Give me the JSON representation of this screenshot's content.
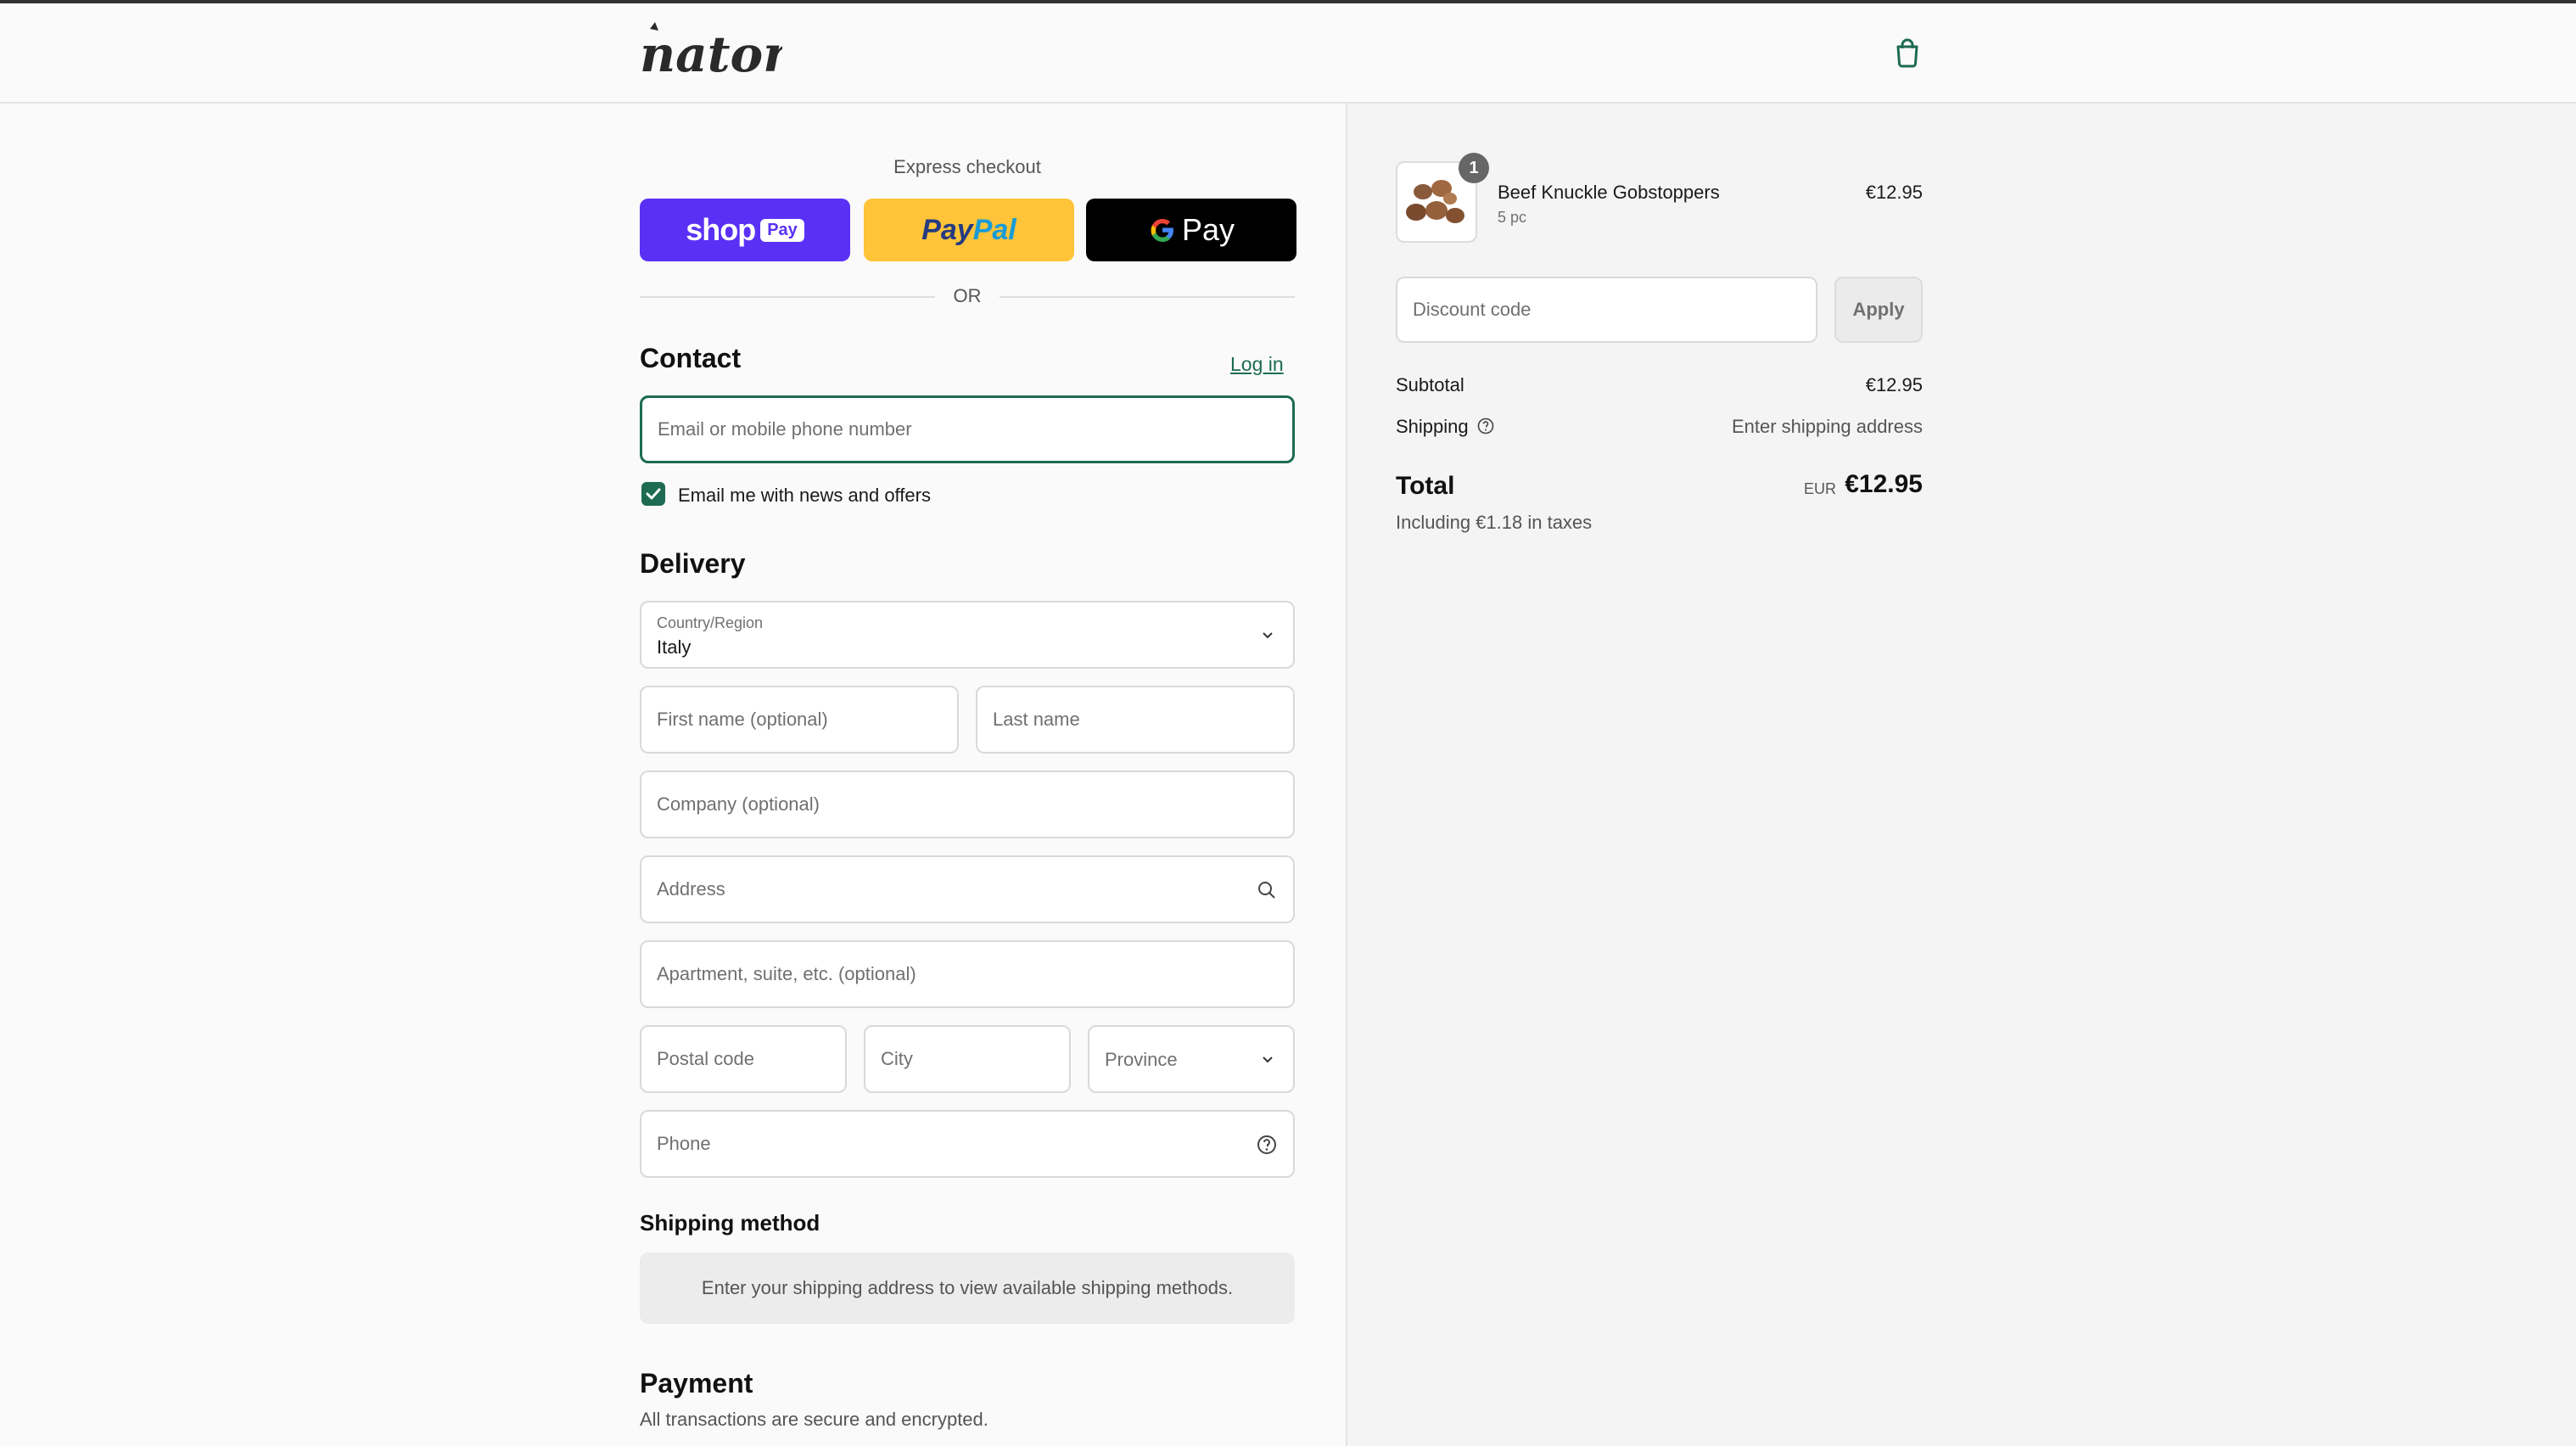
{
  "brand": {
    "name": "natora"
  },
  "express": {
    "title": "Express checkout",
    "shop_pay": {
      "shop": "shop",
      "pay": "Pay"
    },
    "paypal": {
      "pay": "Pay",
      "pal": "Pal"
    },
    "gpay": {
      "label": "Pay"
    },
    "or": "OR"
  },
  "contact": {
    "title": "Contact",
    "login": "Log in",
    "email_placeholder": "Email or mobile phone number",
    "newsletter_label": "Email me with news and offers",
    "newsletter_checked": true
  },
  "delivery": {
    "title": "Delivery",
    "country_label": "Country/Region",
    "country_value": "Italy",
    "first_name_placeholder": "First name (optional)",
    "last_name_placeholder": "Last name",
    "company_placeholder": "Company (optional)",
    "address_placeholder": "Address",
    "apartment_placeholder": "Apartment, suite, etc. (optional)",
    "postal_placeholder": "Postal code",
    "city_placeholder": "City",
    "province_placeholder": "Province",
    "phone_placeholder": "Phone"
  },
  "shipping_method": {
    "title": "Shipping method",
    "message": "Enter your shipping address to view available shipping methods."
  },
  "payment": {
    "title": "Payment",
    "subtitle": "All transactions are secure and encrypted."
  },
  "summary": {
    "item": {
      "name": "Beef Knuckle Gobstoppers",
      "variant": "5 pc",
      "price": "€12.95",
      "quantity": "1"
    },
    "discount_placeholder": "Discount code",
    "apply": "Apply",
    "subtotal_label": "Subtotal",
    "subtotal_value": "€12.95",
    "shipping_label": "Shipping",
    "shipping_value": "Enter shipping address",
    "total_label": "Total",
    "currency": "EUR",
    "total_value": "€12.95",
    "taxes_note": "Including €1.18 in taxes"
  },
  "colors": {
    "accent": "#1d6b52",
    "shop_pay": "#5a31f4",
    "paypal": "#ffc439",
    "gpay": "#000000"
  }
}
